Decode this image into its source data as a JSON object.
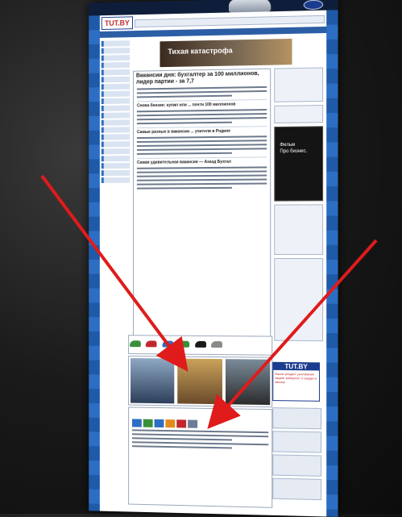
{
  "header": {
    "logo_text": "TUT.BY",
    "banner_text": "Тихая катастрофа"
  },
  "main": {
    "headline": "Вакансии дня: бухгалтер за 100 миллионов, лидер партии - за 7,7",
    "sections": [
      "Снова бензин: купил или ... почти 100 миллионов",
      "Самые разные в вакансии ... учителя в Родине",
      "Самая удивительная вакансия — Ахазд Бухгал"
    ]
  },
  "right": {
    "video_text": "Про бизнес.",
    "video_prefix": "Фильм"
  },
  "bottom_ad": {
    "title": "TUT.BY",
    "promo": "Кассы раздел: рекламная акция! заберите! 3 скидки в месяц!"
  },
  "colors": {
    "arrow": "#e01b1b",
    "brand_blue": "#1b3b8f",
    "brand_red": "#c0272d"
  }
}
